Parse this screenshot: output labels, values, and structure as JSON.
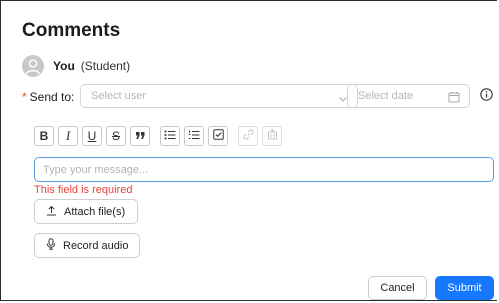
{
  "header": {
    "title": "Comments"
  },
  "author": {
    "name": "You",
    "role": "(Student)",
    "avatar_icon": "user-icon"
  },
  "send": {
    "label": "Send to:",
    "required_marker": "*",
    "user_placeholder": "Select user",
    "date_placeholder": "Select date"
  },
  "toolbar": {
    "bold": "B",
    "italic": "I",
    "underline": "U",
    "strike": "S",
    "icons": [
      "quote-icon",
      "bullet-list-icon",
      "numbered-list-icon",
      "checklist-icon",
      "link-icon",
      "clear-format-icon"
    ]
  },
  "message": {
    "placeholder": "Type your message...",
    "error": "This field is required"
  },
  "actions": {
    "attach": "Attach file(s)",
    "record": "Record audio",
    "cancel": "Cancel",
    "submit": "Submit"
  },
  "colors": {
    "primary": "#1677ff",
    "error": "#e8423b",
    "focus_border": "#5a9be0"
  }
}
